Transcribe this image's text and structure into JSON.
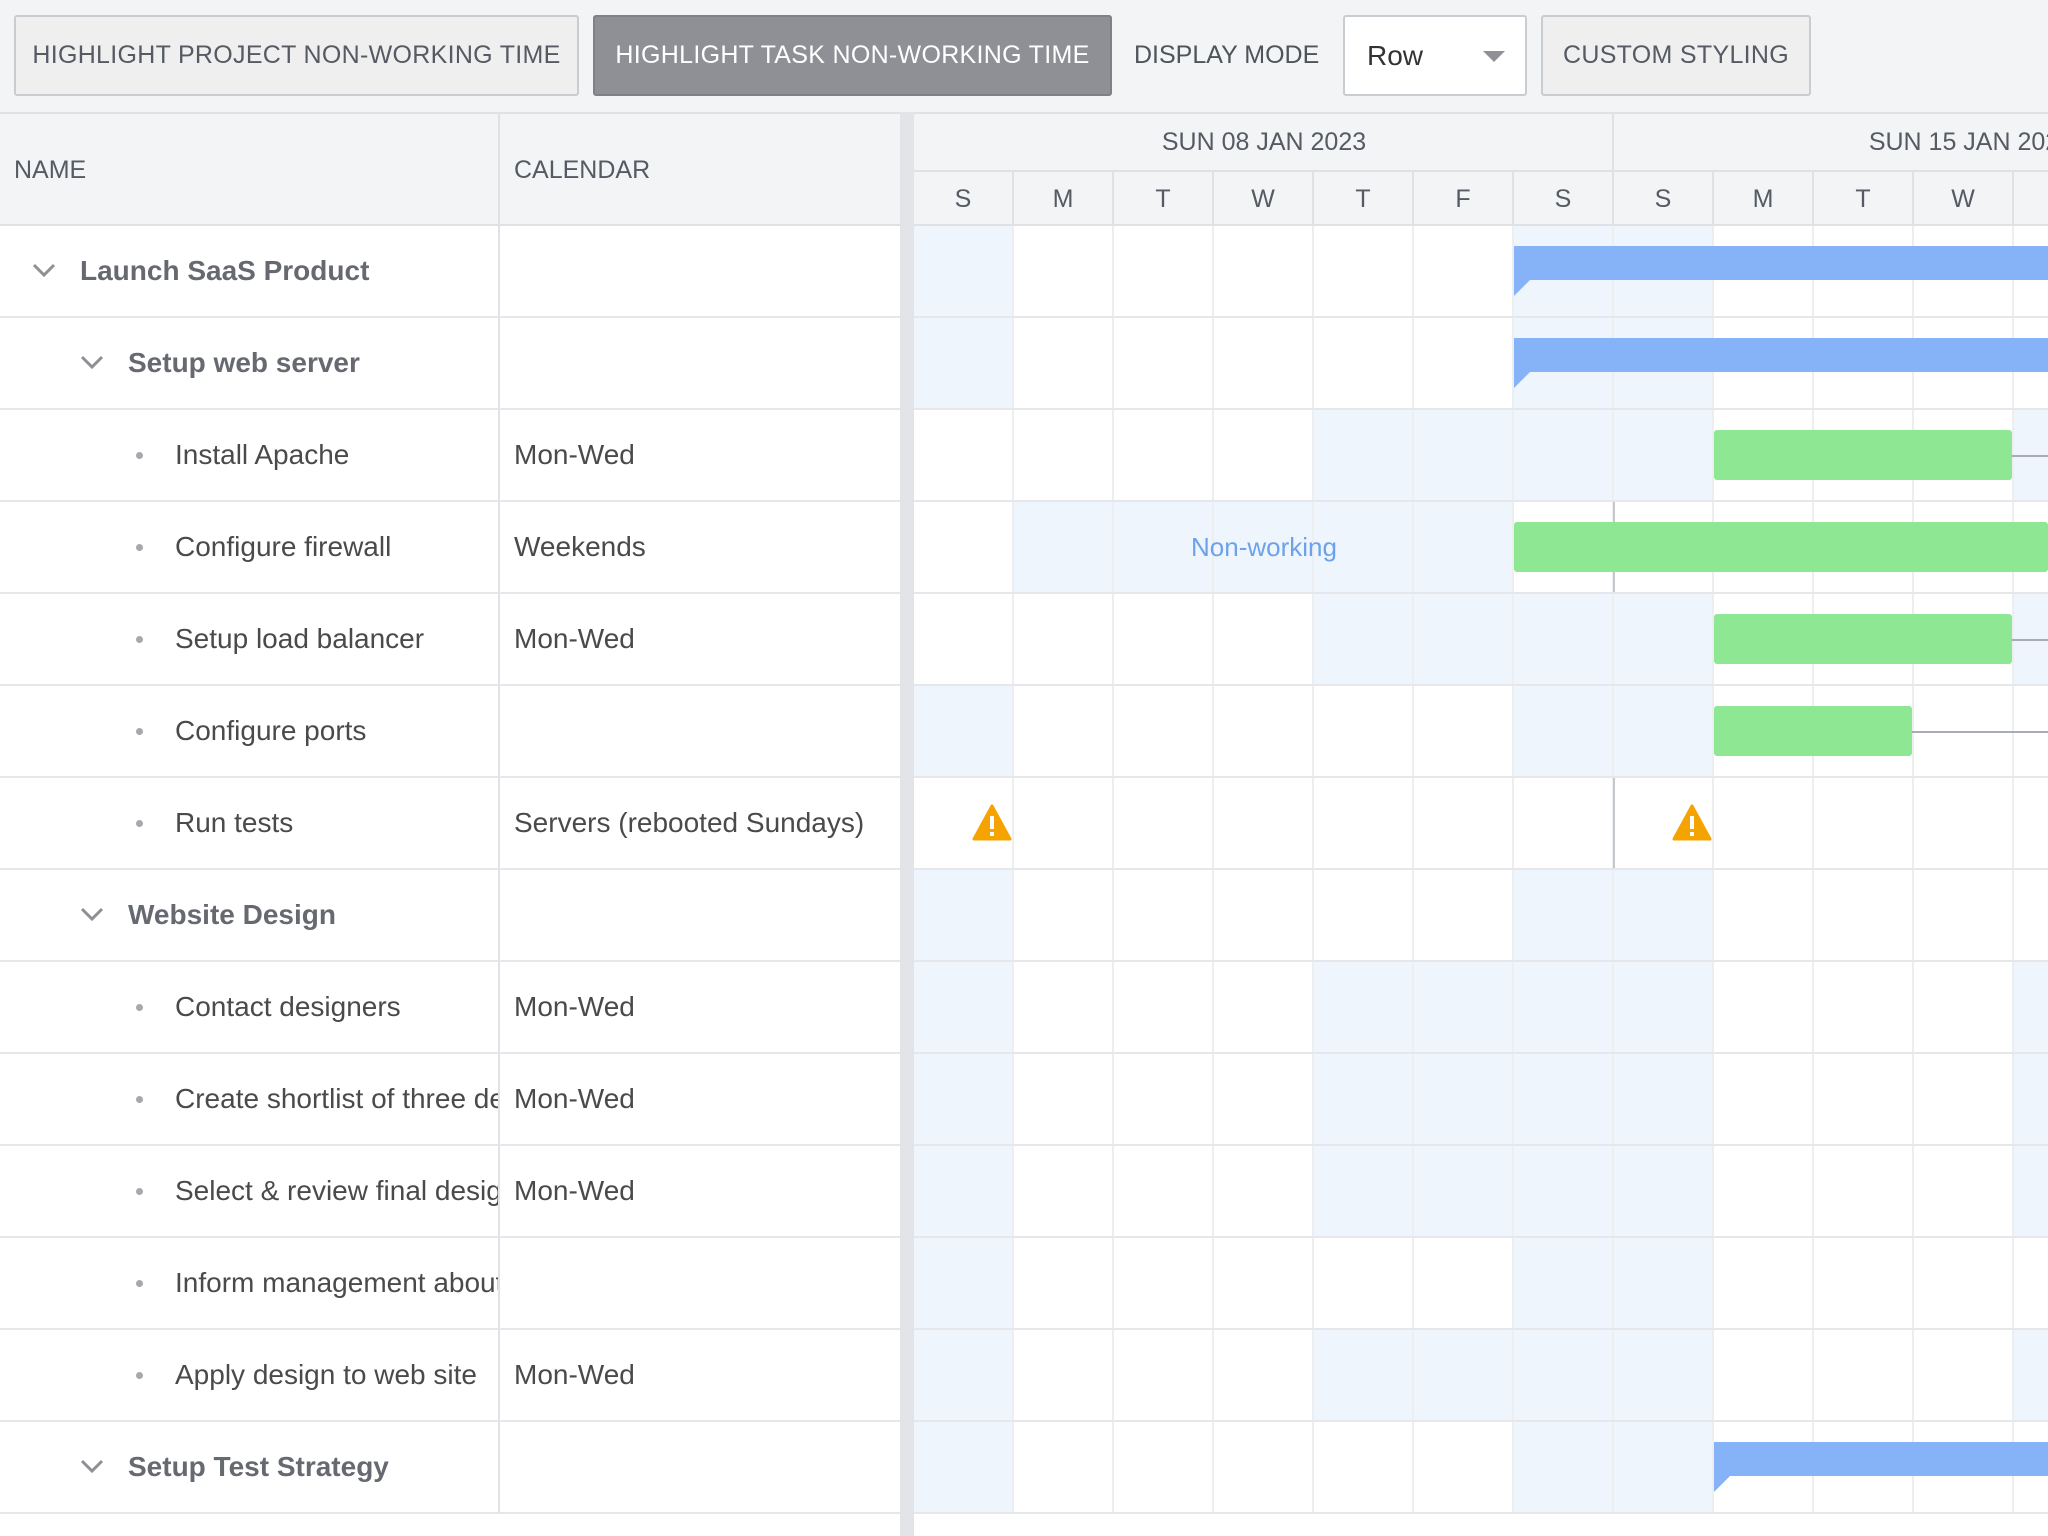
{
  "toolbar": {
    "highlight_project": "HIGHLIGHT PROJECT NON-WORKING TIME",
    "highlight_task": "HIGHLIGHT TASK NON-WORKING TIME",
    "display_mode_label": "DISPLAY MODE",
    "display_mode_value": "Row",
    "custom_styling": "CUSTOM STYLING"
  },
  "grid": {
    "col_name": "NAME",
    "col_calendar": "CALENDAR"
  },
  "timeline": {
    "week1": "SUN 08 JAN 2023",
    "week2": "SUN 15 JAN 202",
    "days": [
      "S",
      "M",
      "T",
      "W",
      "T",
      "F",
      "S",
      "S",
      "M",
      "T",
      "W"
    ],
    "nonworking_label": "Non-working"
  },
  "rows": [
    {
      "name": "Launch SaaS Product",
      "calendar": "",
      "type": "parent"
    },
    {
      "name": "Setup web server",
      "calendar": "",
      "type": "parent"
    },
    {
      "name": "Install Apache",
      "calendar": "Mon-Wed",
      "type": "leaf"
    },
    {
      "name": "Configure firewall",
      "calendar": "Weekends",
      "type": "leaf"
    },
    {
      "name": "Setup load balancer",
      "calendar": "Mon-Wed",
      "type": "leaf"
    },
    {
      "name": "Configure ports",
      "calendar": "",
      "type": "leaf"
    },
    {
      "name": "Run tests",
      "calendar": "Servers (rebooted Sundays)",
      "type": "leaf"
    },
    {
      "name": "Website Design",
      "calendar": "",
      "type": "parent"
    },
    {
      "name": "Contact designers",
      "calendar": "Mon-Wed",
      "type": "leaf"
    },
    {
      "name": "Create shortlist of three designers",
      "calendar": "Mon-Wed",
      "type": "leaf"
    },
    {
      "name": "Select & review final design",
      "calendar": "Mon-Wed",
      "type": "leaf"
    },
    {
      "name": "Inform management about decision",
      "calendar": "",
      "type": "leaf"
    },
    {
      "name": "Apply design to web site",
      "calendar": "Mon-Wed",
      "type": "leaf"
    },
    {
      "name": "Setup Test Strategy",
      "calendar": "",
      "type": "parent"
    }
  ],
  "colors": {
    "parent_bar": "#86b3f7",
    "task_bar": "#8ee792",
    "nonworking_shade": "#eef5fd",
    "warning": "#f5a300"
  }
}
